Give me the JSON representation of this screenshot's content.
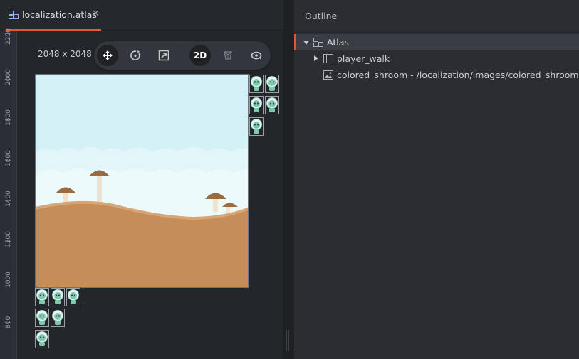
{
  "tab": {
    "label": "localization.atlas",
    "close": "✕",
    "icon": "atlas-icon"
  },
  "scene": {
    "dimensions": "2048 x 2048 (",
    "toolbar": {
      "move_icon": "move-icon",
      "rotate_icon": "rotate-icon",
      "scale_icon": "scale-icon",
      "mode_2d_label": "2D",
      "perspective_icon": "perspective-icon",
      "camera_icon": "camera-reset-icon"
    }
  },
  "ruler": {
    "labels": [
      "2200",
      "2000",
      "1800",
      "1600",
      "1400",
      "1200",
      "1000",
      "800"
    ]
  },
  "outline": {
    "title": "Outline",
    "items": [
      {
        "label": "Atlas",
        "icon": "atlas-icon",
        "expanded": true
      },
      {
        "label": "player_walk",
        "icon": "animation-icon",
        "expanded": false
      },
      {
        "label": "colored_shroom - /localization/images/colored_shroom.png",
        "icon": "image-icon"
      }
    ]
  },
  "colors": {
    "accent": "#e05a2b",
    "sky": "#cfeef3",
    "ground": "#c48d5a",
    "mushroom_cap": "#9a6b3f"
  }
}
